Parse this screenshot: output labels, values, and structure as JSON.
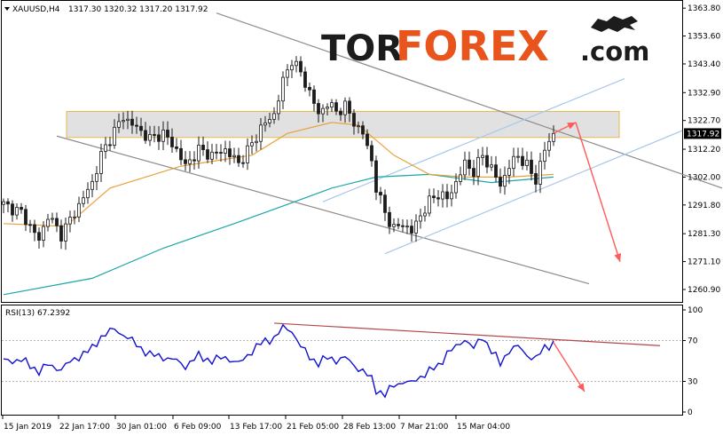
{
  "header": {
    "symbol": "XAUUSD,H4",
    "ohlc": "1317.30 1320.32 1317.20 1317.92",
    "rsi_label": "RSI(13) 67.2392"
  },
  "logo": {
    "part1": "TOR",
    "part2": "FOREX",
    "part3": ".com"
  },
  "colors": {
    "candle": "#1c1c1c",
    "ma_fast": "#e8a23c",
    "ma_slow": "#1aa6a6",
    "rsi": "#1010d0",
    "channel": "#8c8c8c",
    "channel_up": "#a8c8e8",
    "zone_fill": "#dcdcdc",
    "zone_border": "#e8b84c",
    "forecast": "#ff5a5a",
    "rsi_trend": "#b44646",
    "price_tag_bg": "#000000"
  },
  "chart_data": [
    {
      "type": "candlestick",
      "title": "XAUUSD,H4",
      "ylim": [
        1257.0,
        1364.5
      ],
      "y_ticks": [
        "1363.80",
        "1353.60",
        "1343.40",
        "1332.90",
        "1322.70",
        "1312.20",
        "1302.00",
        "1291.80",
        "1281.30",
        "1271.10",
        "1260.90"
      ],
      "current_price": "1317.92",
      "x_labels": [
        "15 Jan 2019",
        "22 Jan 17:00",
        "30 Jan 01:00",
        "6 Feb 09:00",
        "13 Feb 17:00",
        "21 Feb 05:00",
        "28 Feb 13:00",
        "7 Mar 21:00",
        "15 Mar 04:00"
      ],
      "close_path": [
        [
          0,
          1292
        ],
        [
          4,
          1289
        ],
        [
          8,
          1279
        ],
        [
          10,
          1288
        ],
        [
          13,
          1281
        ],
        [
          16,
          1289
        ],
        [
          20,
          1300
        ],
        [
          22,
          1310
        ],
        [
          25,
          1319
        ],
        [
          27,
          1324
        ],
        [
          30,
          1320
        ],
        [
          33,
          1316
        ],
        [
          36,
          1318
        ],
        [
          39,
          1312
        ],
        [
          41,
          1306
        ],
        [
          44,
          1312
        ],
        [
          47,
          1310
        ],
        [
          50,
          1312
        ],
        [
          53,
          1307
        ],
        [
          56,
          1314
        ],
        [
          58,
          1320
        ],
        [
          61,
          1325
        ],
        [
          63,
          1337
        ],
        [
          65,
          1345
        ],
        [
          67,
          1340
        ],
        [
          69,
          1333
        ],
        [
          71,
          1325
        ],
        [
          73,
          1329
        ],
        [
          75,
          1326
        ],
        [
          77,
          1328
        ],
        [
          79,
          1322
        ],
        [
          81,
          1318
        ],
        [
          83,
          1308
        ],
        [
          84,
          1298
        ],
        [
          86,
          1289
        ],
        [
          88,
          1283
        ],
        [
          90,
          1285
        ],
        [
          92,
          1282
        ],
        [
          94,
          1288
        ],
        [
          96,
          1293
        ],
        [
          98,
          1296
        ],
        [
          100,
          1294
        ],
        [
          102,
          1300
        ],
        [
          104,
          1307
        ],
        [
          106,
          1304
        ],
        [
          108,
          1310
        ],
        [
          110,
          1305
        ],
        [
          112,
          1299
        ],
        [
          114,
          1306
        ],
        [
          116,
          1310
        ],
        [
          118,
          1306
        ],
        [
          120,
          1301
        ],
        [
          122,
          1312
        ],
        [
          124,
          1318
        ]
      ],
      "ma_fast": [
        [
          0,
          1285
        ],
        [
          14,
          1284
        ],
        [
          24,
          1298
        ],
        [
          40,
          1306
        ],
        [
          56,
          1310
        ],
        [
          64,
          1318
        ],
        [
          74,
          1322
        ],
        [
          80,
          1321
        ],
        [
          88,
          1310
        ],
        [
          96,
          1303
        ],
        [
          104,
          1302
        ],
        [
          114,
          1302
        ],
        [
          124,
          1303
        ]
      ],
      "ma_slow": [
        [
          0,
          1259
        ],
        [
          20,
          1265
        ],
        [
          36,
          1276
        ],
        [
          52,
          1285
        ],
        [
          64,
          1292
        ],
        [
          74,
          1298
        ],
        [
          84,
          1302
        ],
        [
          96,
          1303
        ],
        [
          110,
          1300
        ],
        [
          124,
          1302
        ]
      ],
      "resistance_zone": [
        1316.5,
        1326.0
      ],
      "channel_down_top": [
        [
          48,
          1362
        ],
        [
          162,
          1298
        ]
      ],
      "channel_down_bottom": [
        [
          12,
          1317
        ],
        [
          132,
          1263
        ]
      ],
      "channel_up_top": [
        [
          72,
          1293
        ],
        [
          140,
          1338
        ]
      ],
      "channel_up_bottom": [
        [
          86,
          1274
        ],
        [
          153,
          1319
        ]
      ],
      "forecast_up": [
        [
          124,
          1318
        ],
        [
          129,
          1322
        ]
      ],
      "forecast_down": [
        [
          129,
          1322
        ],
        [
          139,
          1271
        ]
      ]
    },
    {
      "type": "line",
      "title": "RSI(13) 67.2392",
      "ylim": [
        0,
        100
      ],
      "y_ticks": [
        "100",
        "70",
        "30",
        "0"
      ],
      "levels": [
        30,
        70
      ],
      "values_path": [
        [
          0,
          50
        ],
        [
          4,
          51
        ],
        [
          8,
          40
        ],
        [
          10,
          46
        ],
        [
          13,
          42
        ],
        [
          16,
          52
        ],
        [
          20,
          62
        ],
        [
          22,
          74
        ],
        [
          25,
          81
        ],
        [
          27,
          76
        ],
        [
          30,
          66
        ],
        [
          33,
          56
        ],
        [
          36,
          54
        ],
        [
          39,
          50
        ],
        [
          41,
          45
        ],
        [
          44,
          55
        ],
        [
          47,
          50
        ],
        [
          50,
          54
        ],
        [
          53,
          47
        ],
        [
          56,
          60
        ],
        [
          58,
          67
        ],
        [
          61,
          73
        ],
        [
          63,
          82
        ],
        [
          65,
          80
        ],
        [
          67,
          64
        ],
        [
          69,
          54
        ],
        [
          71,
          48
        ],
        [
          73,
          53
        ],
        [
          75,
          51
        ],
        [
          77,
          53
        ],
        [
          79,
          46
        ],
        [
          81,
          40
        ],
        [
          83,
          32
        ],
        [
          84,
          22
        ],
        [
          86,
          17
        ],
        [
          88,
          26
        ],
        [
          90,
          30
        ],
        [
          92,
          28
        ],
        [
          94,
          35
        ],
        [
          96,
          40
        ],
        [
          98,
          45
        ],
        [
          100,
          58
        ],
        [
          102,
          63
        ],
        [
          104,
          72
        ],
        [
          106,
          62
        ],
        [
          108,
          74
        ],
        [
          110,
          60
        ],
        [
          112,
          47
        ],
        [
          114,
          61
        ],
        [
          116,
          64
        ],
        [
          118,
          56
        ],
        [
          120,
          52
        ],
        [
          122,
          63
        ],
        [
          124,
          68
        ]
      ],
      "trendline": [
        [
          61,
          87
        ],
        [
          148,
          65
        ]
      ],
      "forecast_down": [
        [
          124,
          68
        ],
        [
          131,
          20
        ]
      ]
    }
  ]
}
